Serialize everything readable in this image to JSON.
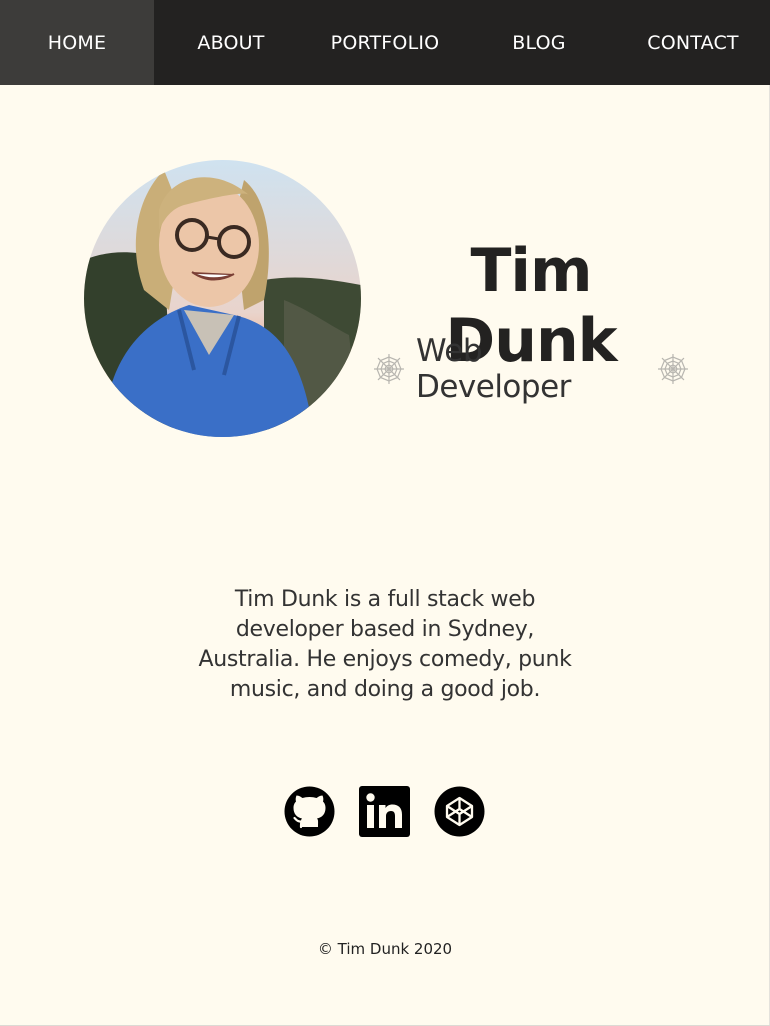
{
  "nav": {
    "items": [
      {
        "label": "HOME",
        "active": true
      },
      {
        "label": "ABOUT",
        "active": false
      },
      {
        "label": "PORTFOLIO",
        "active": false
      },
      {
        "label": "BLOG",
        "active": false
      },
      {
        "label": "CONTACT",
        "active": false
      }
    ]
  },
  "hero": {
    "name": "Tim Dunk",
    "role": "Web Developer",
    "role_icon": "spider-web-icon"
  },
  "bio": "Tim Dunk is a full stack web developer based in Sydney, Australia. He enjoys comedy, punk music, and doing a good job.",
  "socials": [
    {
      "name": "github-icon"
    },
    {
      "name": "linkedin-icon"
    },
    {
      "name": "codepen-icon"
    }
  ],
  "footer": {
    "copyright": "© Tim Dunk 2020"
  },
  "colors": {
    "nav_bg": "#232221",
    "nav_active_bg": "#3d3c3a",
    "page_bg": "#fffbef",
    "text": "#333333"
  }
}
